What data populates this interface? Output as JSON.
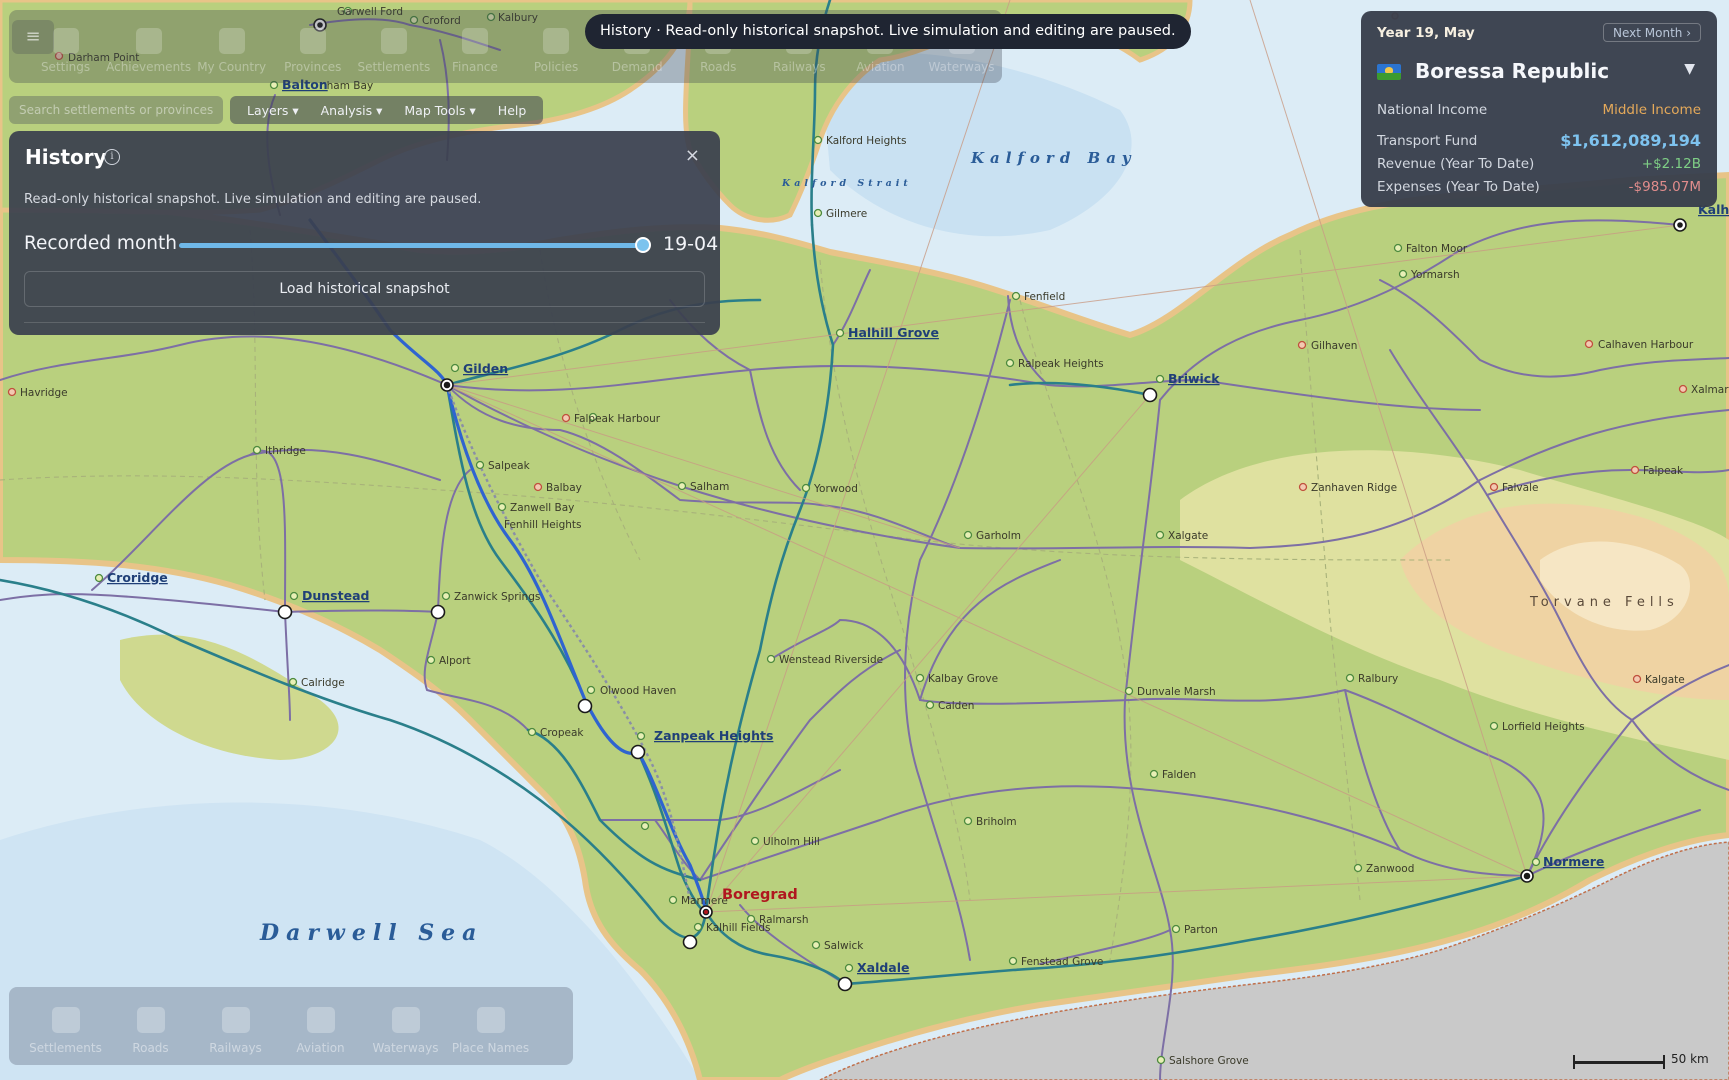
{
  "banner": "History · Read-only historical snapshot. Live simulation and editing are paused.",
  "toolbar": {
    "items": [
      "Settings",
      "Achievements",
      "My Country",
      "Provinces",
      "Settlements",
      "Finance",
      "Policies",
      "Demand",
      "Roads",
      "Railways",
      "Aviation",
      "Waterways"
    ]
  },
  "search": {
    "placeholder": "Search settlements or provinces"
  },
  "menubar": {
    "items": [
      "Layers",
      "Analysis",
      "Map Tools",
      "Help"
    ]
  },
  "history": {
    "title": "History",
    "description": "Read-only historical snapshot. Live simulation and editing are paused.",
    "recorded_label": "Recorded month",
    "recorded_value": "19-04",
    "slider_fraction": 1.0,
    "load_button": "Load historical snapshot",
    "close_glyph": "×",
    "info_glyph": "i"
  },
  "country": {
    "date": "Year 19, May",
    "next_button": "Next Month ›",
    "name": "Boressa Republic",
    "national_income_label": "National Income",
    "national_income_value": "Middle Income",
    "fund_label": "Transport Fund",
    "fund_value": "$1,612,089,194",
    "revenue_label": "Revenue (Year To Date)",
    "revenue_value": "+$2.12B",
    "expenses_label": "Expenses (Year To Date)",
    "expenses_value": "-$985.07M"
  },
  "layerbar": {
    "items": [
      "Settlements",
      "Roads",
      "Railways",
      "Aviation",
      "Waterways",
      "Place Names"
    ]
  },
  "map": {
    "seas": {
      "darwell": "Darwell Sea",
      "kalford_bay": "Kalford Bay",
      "kalford_strait": "Kalford Strait"
    },
    "region": "Torvane Fells",
    "scale": "50 km",
    "capital": "Boregrad",
    "cities": [
      "Gilden",
      "Halhill Grove",
      "Briwick",
      "Croridge",
      "Dunstead",
      "Zanpeak Heights",
      "Xaldale",
      "Normere",
      "Balton",
      "Kalha"
    ],
    "towns": [
      "Garwell Ford",
      "Croford",
      "Kalbury",
      "Darham Point",
      "Kalford Heights",
      "Gilmere",
      "Fenfield",
      "Ralpeak Heights",
      "Falton Moor",
      "Yormarsh",
      "Gilhaven",
      "Calhaven Harbour",
      "Xalmars",
      "Havridge",
      "Falpeak Harbour",
      "Ithridge",
      "Salpeak",
      "Balbay",
      "Zanwell Bay",
      "Fenhill Heights",
      "Salham",
      "Yorwood",
      "Zanhaven Ridge",
      "Falvale",
      "Falpeak",
      "Garholm",
      "Xalgate",
      "Zanwick Springs",
      "Alport",
      "Calridge",
      "Wenstead Riverside",
      "Olwood Haven",
      "Kalbay Grove",
      "Calden",
      "Dunvale Marsh",
      "Ralbury",
      "Kalgate",
      "Lorfield Heights",
      "Cropeak",
      "Falden",
      "Ulholm Hill",
      "Briholm",
      "Zanwood",
      "Marmere",
      "Ralmarsh",
      "Kalhill Fields",
      "Salwick",
      "Parton",
      "Fenstead Grove",
      "Salshore Grove",
      "nham Bay"
    ]
  }
}
